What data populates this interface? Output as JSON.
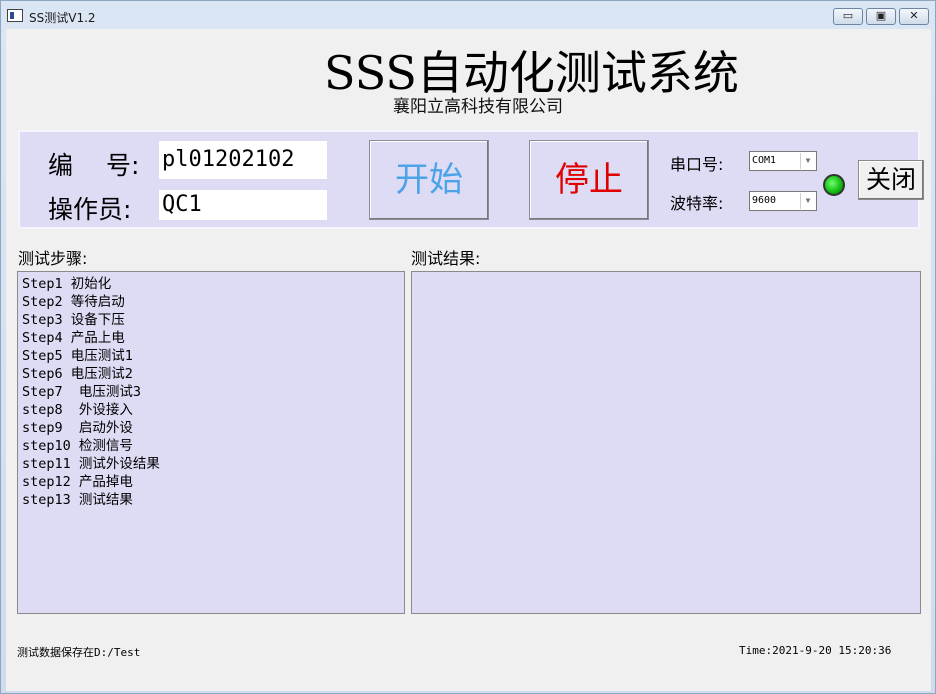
{
  "window": {
    "title": "SS测试V1.2",
    "minimize_glyph": "▭",
    "maximize_glyph": "▣",
    "close_glyph": "✕"
  },
  "header": {
    "title": "SSS自动化测试系统",
    "company": "襄阳立高科技有限公司"
  },
  "controls": {
    "serial_label": "编　 号:",
    "serial_value": "pl01202102",
    "operator_label": "操作员:",
    "operator_value": "QC1",
    "start_label": "开始",
    "start_color": "#4da3e8",
    "stop_label": "停止",
    "stop_color": "#e00000",
    "port_label": "串口号:",
    "port_value": "COM1",
    "baud_label": "波特率:",
    "baud_value": "9600",
    "status_led_color": "#18c018",
    "close_label": "关闭"
  },
  "steps": {
    "label": "测试步骤:",
    "items": [
      "Step1 初始化",
      "Step2 等待启动",
      "Step3 设备下压",
      "Step4 产品上电",
      "Step5 电压测试1",
      "Step6 电压测试2",
      "Step7  电压测试3",
      "step8  外设接入",
      "step9  启动外设",
      "step10 检测信号",
      "step11 测试外设结果",
      "step12 产品掉电",
      "step13 测试结果"
    ]
  },
  "results": {
    "label": "测试结果:"
  },
  "footer": {
    "save_path": "测试数据保存在D:/Test",
    "time": "Time:2021-9-20 15:20:36"
  }
}
